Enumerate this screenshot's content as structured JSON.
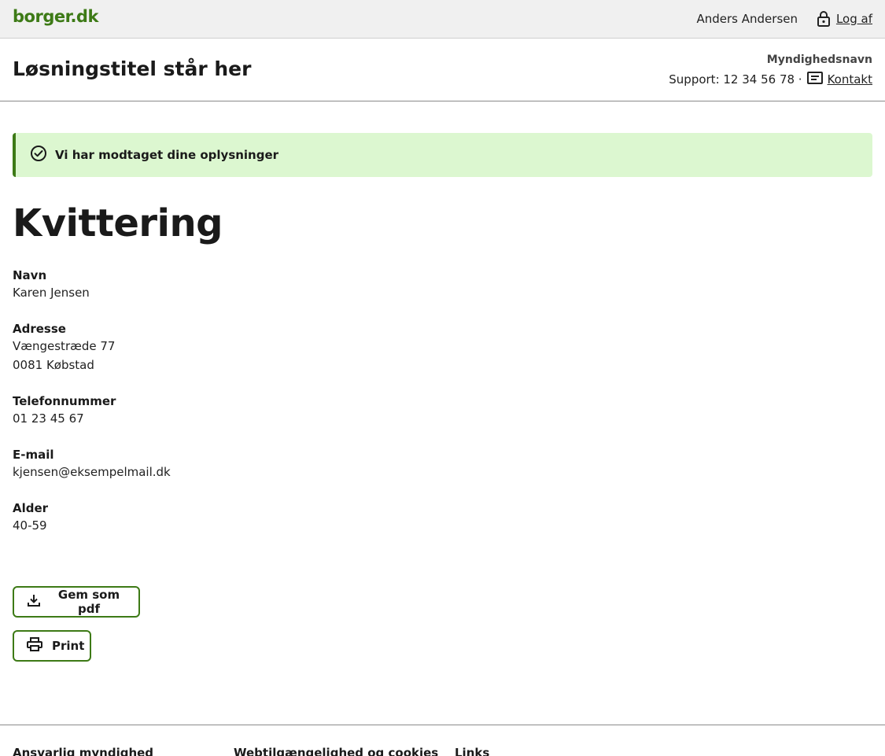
{
  "topbar": {
    "logo": "borger.dk",
    "user_name": "Anders Andersen",
    "logout_label": "Log af"
  },
  "header": {
    "solution_title": "Løsningstitel står her",
    "authority": "Myndighedsnavn",
    "support_text": "Support: 12 34 56 78 ·",
    "contact_label": "Kontakt"
  },
  "alert": {
    "message": "Vi har modtaget dine oplysninger"
  },
  "main": {
    "heading": "Kvittering",
    "fields": [
      {
        "label": "Navn",
        "lines": [
          "Karen Jensen"
        ]
      },
      {
        "label": "Adresse",
        "lines": [
          "Vængestræde 77",
          "0081 Købstad"
        ]
      },
      {
        "label": "Telefonnummer",
        "lines": [
          "01 23 45 67"
        ]
      },
      {
        "label": "E-mail",
        "lines": [
          "kjensen@eksempelmail.dk"
        ]
      },
      {
        "label": "Alder",
        "lines": [
          "40-59"
        ]
      }
    ],
    "save_pdf_label": "Gem som pdf",
    "print_label": "Print"
  },
  "footer": {
    "columns": [
      "Ansvarlig myndighed",
      "Webtilgængelighed og cookies",
      "Links"
    ]
  },
  "colors": {
    "brand_green": "#3d7a16",
    "alert_background": "#dcf7d0"
  }
}
